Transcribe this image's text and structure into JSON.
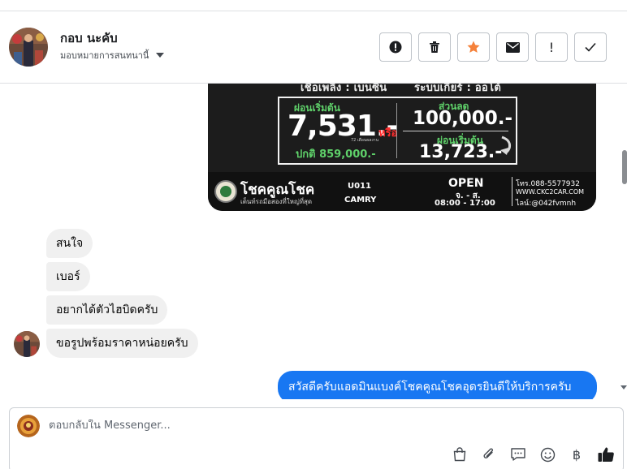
{
  "header": {
    "contact_name": "กอบ นะคับ",
    "contact_subtitle": "มอบหมายการสนทนานี้",
    "actions": [
      {
        "name": "spam-button",
        "icon": "alert-circle-icon"
      },
      {
        "name": "delete-button",
        "icon": "trash-icon"
      },
      {
        "name": "star-button",
        "icon": "star-icon",
        "color": "#f5813a"
      },
      {
        "name": "mail-button",
        "icon": "envelope-icon"
      },
      {
        "name": "mark-button",
        "label": "!"
      },
      {
        "name": "done-button",
        "icon": "check-icon"
      }
    ]
  },
  "ad": {
    "top_left": "เชื้อเพลิง : เบนซิน",
    "top_right": "ระบบเกียร์ : ออโต้",
    "start_label": "ผ่อนเริ่มต้น",
    "start_amount": "7,531.-",
    "small_note": "72 เดือนผลงาน",
    "or_label": "หรือ",
    "normal_price": "ปกติ 859,000.-",
    "discount_label": "ส่วนลด",
    "discount_amount": "100,000.-",
    "start_label_2": "ผ่อนเริ่มต้น",
    "start_amount_2": "13,723.-",
    "brand": "โชคคูณโชค",
    "brand_sub": "เต็นท์รถมือสองที่ใหญ่ที่สุด",
    "code": "U011",
    "model": "CAMRY",
    "open": "OPEN",
    "days": "จ. - ส.",
    "hours": "08:00 - 17:00",
    "phone": "โทร.088-5577932",
    "web": "WWW.CKC2CAR.COM",
    "line": "ไลน์:@042fvmnh"
  },
  "messages_in": [
    "สนใจ",
    "เบอร์",
    "อยากได้ตัวไฮบิดครับ",
    "ขอรูปพร้อมราคาหน่อยครับ"
  ],
  "message_out": "สวัสดีครับแอดมินแบงค์โชคคูณโชคอุดรยินดีให้บริการครับ",
  "composer": {
    "placeholder": "ตอบกลับใน Messenger...",
    "tools": [
      "shopping-bag-icon",
      "paperclip-icon",
      "saved-reply-icon",
      "emoji-icon",
      "baht-icon",
      "thumbs-up-icon"
    ],
    "baht_symbol": "฿"
  },
  "colors": {
    "accent": "#1877f2",
    "star": "#f5813a"
  }
}
